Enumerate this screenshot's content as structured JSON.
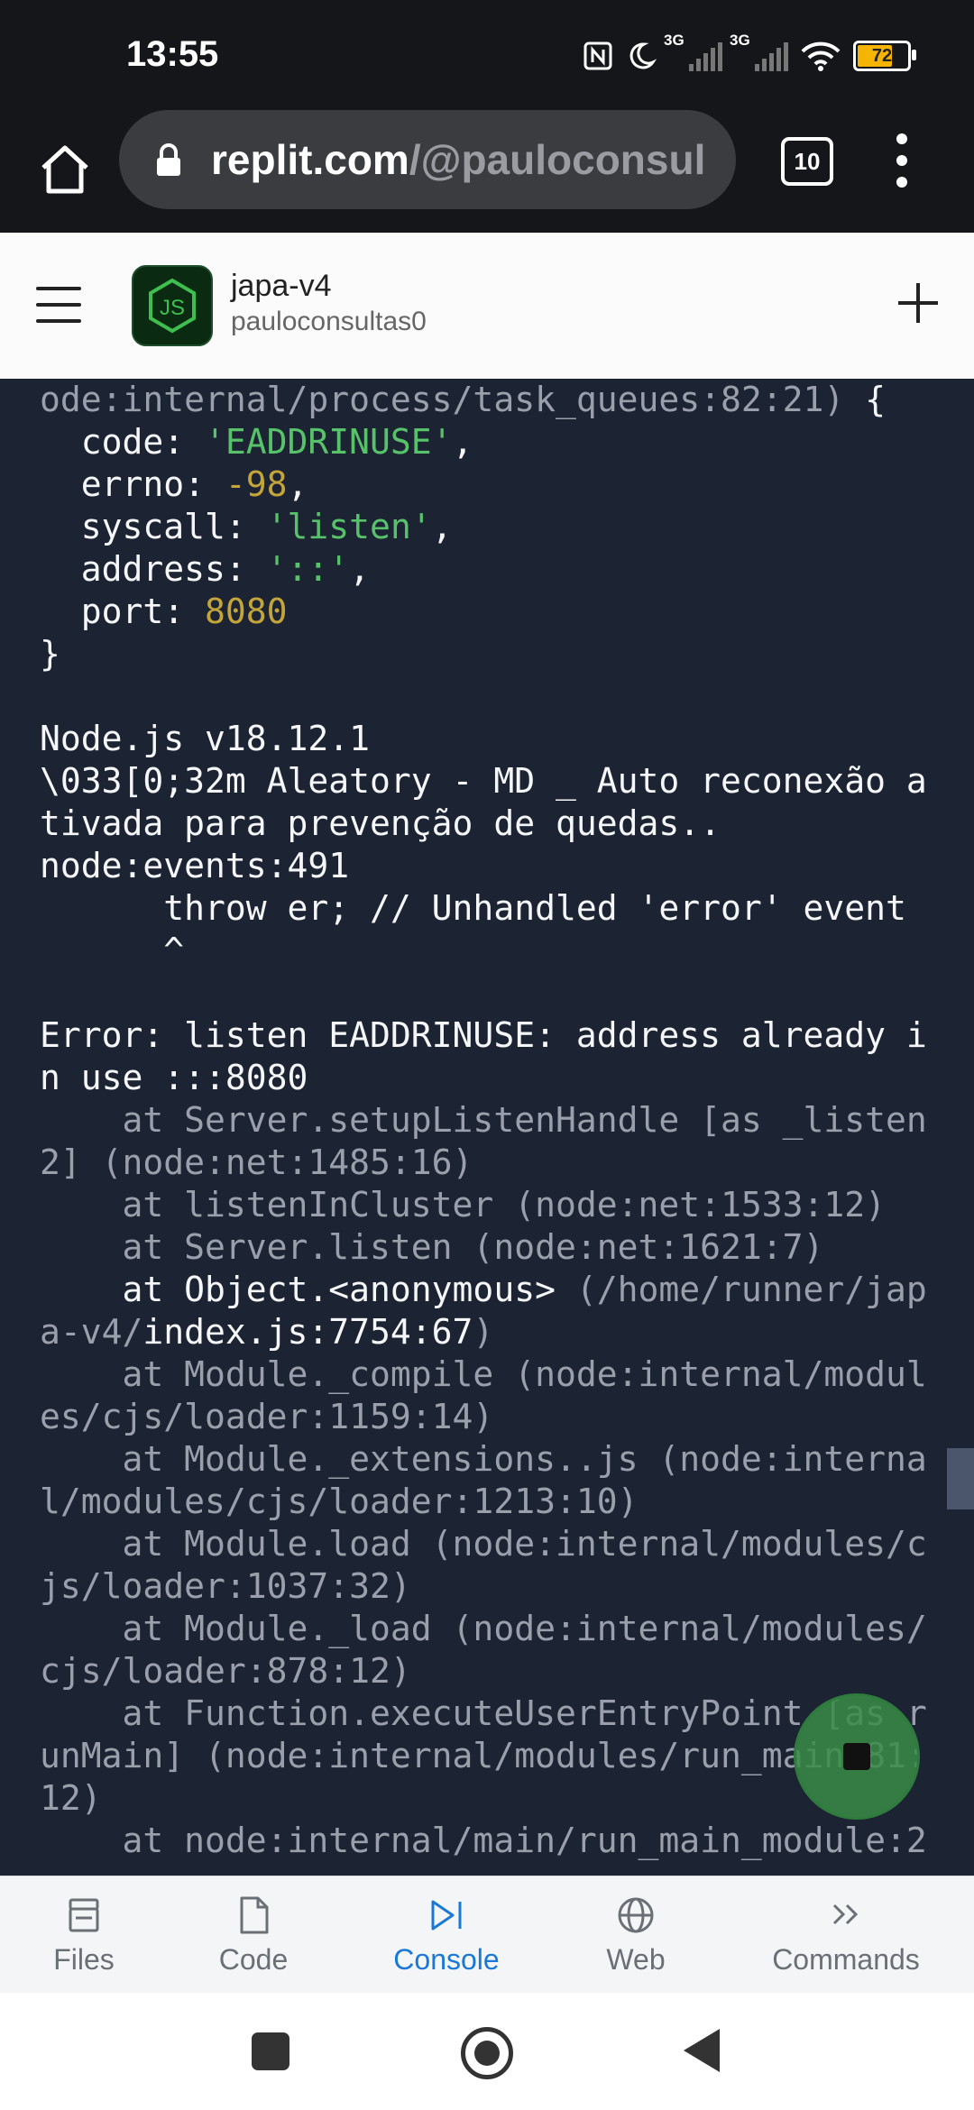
{
  "status_bar": {
    "time": "13:55",
    "network1": "3G",
    "network2": "3G",
    "battery": "72",
    "battery_level": 0.72
  },
  "browser": {
    "url_host": "replit.com",
    "url_path": "/@pauloconsul",
    "tab_count": "10"
  },
  "header": {
    "repl_name": "japa-v4",
    "owner": "pauloconsultas0",
    "logo_text": "JS"
  },
  "console": {
    "lines": [
      [
        {
          "t": "ode:internal/process/task_queues:82:21)",
          "c": "dim"
        },
        {
          "t": " {",
          "c": ""
        }
      ],
      [
        {
          "t": "  code: ",
          "c": ""
        },
        {
          "t": "'EADDRINUSE'",
          "c": "green"
        },
        {
          "t": ",",
          "c": ""
        }
      ],
      [
        {
          "t": "  errno: ",
          "c": ""
        },
        {
          "t": "-98",
          "c": "yellow"
        },
        {
          "t": ",",
          "c": ""
        }
      ],
      [
        {
          "t": "  syscall: ",
          "c": ""
        },
        {
          "t": "'listen'",
          "c": "green"
        },
        {
          "t": ",",
          "c": ""
        }
      ],
      [
        {
          "t": "  address: ",
          "c": ""
        },
        {
          "t": "'::'",
          "c": "green"
        },
        {
          "t": ",",
          "c": ""
        }
      ],
      [
        {
          "t": "  port: ",
          "c": ""
        },
        {
          "t": "8080",
          "c": "yellow"
        }
      ],
      [
        {
          "t": "}",
          "c": ""
        }
      ],
      [
        {
          "t": "",
          "c": ""
        }
      ],
      [
        {
          "t": "Node.js v18.12.1",
          "c": ""
        }
      ],
      [
        {
          "t": "\\033[0;32m Aleatory - MD _ Auto reconexão a",
          "c": ""
        }
      ],
      [
        {
          "t": "tivada para prevenção de quedas..",
          "c": ""
        }
      ],
      [
        {
          "t": "node:events:491",
          "c": ""
        }
      ],
      [
        {
          "t": "      throw er; // Unhandled 'error' event",
          "c": ""
        }
      ],
      [
        {
          "t": "      ^",
          "c": ""
        }
      ],
      [
        {
          "t": "",
          "c": ""
        }
      ],
      [
        {
          "t": "Error: listen EADDRINUSE: address already i",
          "c": ""
        }
      ],
      [
        {
          "t": "n use :::8080",
          "c": ""
        }
      ],
      [
        {
          "t": "    at Server.setupListenHandle [as _listen",
          "c": "dim"
        }
      ],
      [
        {
          "t": "2] (node:net:1485:16)",
          "c": "dim"
        }
      ],
      [
        {
          "t": "    at listenInCluster (node:net:1533:12)",
          "c": "dim"
        }
      ],
      [
        {
          "t": "    at Server.listen (node:net:1621:7)",
          "c": "dim"
        }
      ],
      [
        {
          "t": "    at Object.<anonymous> ",
          "c": ""
        },
        {
          "t": "(/home/runner/jap",
          "c": "dim"
        }
      ],
      [
        {
          "t": "a-v4/",
          "c": "dim"
        },
        {
          "t": "index.js:7754:67",
          "c": ""
        },
        {
          "t": ")",
          "c": "dim"
        }
      ],
      [
        {
          "t": "    at Module._compile (node:internal/modul",
          "c": "dim"
        }
      ],
      [
        {
          "t": "es/cjs/loader:1159:14)",
          "c": "dim"
        }
      ],
      [
        {
          "t": "    at Module._extensions..js (node:interna",
          "c": "dim"
        }
      ],
      [
        {
          "t": "l/modules/cjs/loader:1213:10)",
          "c": "dim"
        }
      ],
      [
        {
          "t": "    at Module.load (node:internal/modules/c",
          "c": "dim"
        }
      ],
      [
        {
          "t": "js/loader:1037:32)",
          "c": "dim"
        }
      ],
      [
        {
          "t": "    at Module._load (node:internal/modules/",
          "c": "dim"
        }
      ],
      [
        {
          "t": "cjs/loader:878:12)",
          "c": "dim"
        }
      ],
      [
        {
          "t": "    at Function.executeUserEntryPoint [as r",
          "c": "dim"
        }
      ],
      [
        {
          "t": "unMain] (node:internal/modules/run_main:81:",
          "c": "dim"
        }
      ],
      [
        {
          "t": "12)",
          "c": "dim"
        }
      ],
      [
        {
          "t": "    at node:internal/main/run_main_module:2",
          "c": "dim"
        }
      ]
    ]
  },
  "nav": {
    "items": [
      {
        "label": "Files",
        "icon": "files-icon"
      },
      {
        "label": "Code",
        "icon": "file-icon"
      },
      {
        "label": "Console",
        "icon": "console-icon"
      },
      {
        "label": "Web",
        "icon": "globe-icon"
      },
      {
        "label": "Commands",
        "icon": "chevrons-right-icon"
      }
    ],
    "active": "Console"
  },
  "colors": {
    "console_bg": "#1c2333",
    "accent": "#1a79d6",
    "string": "#58c26b",
    "number": "#c4a53a"
  }
}
